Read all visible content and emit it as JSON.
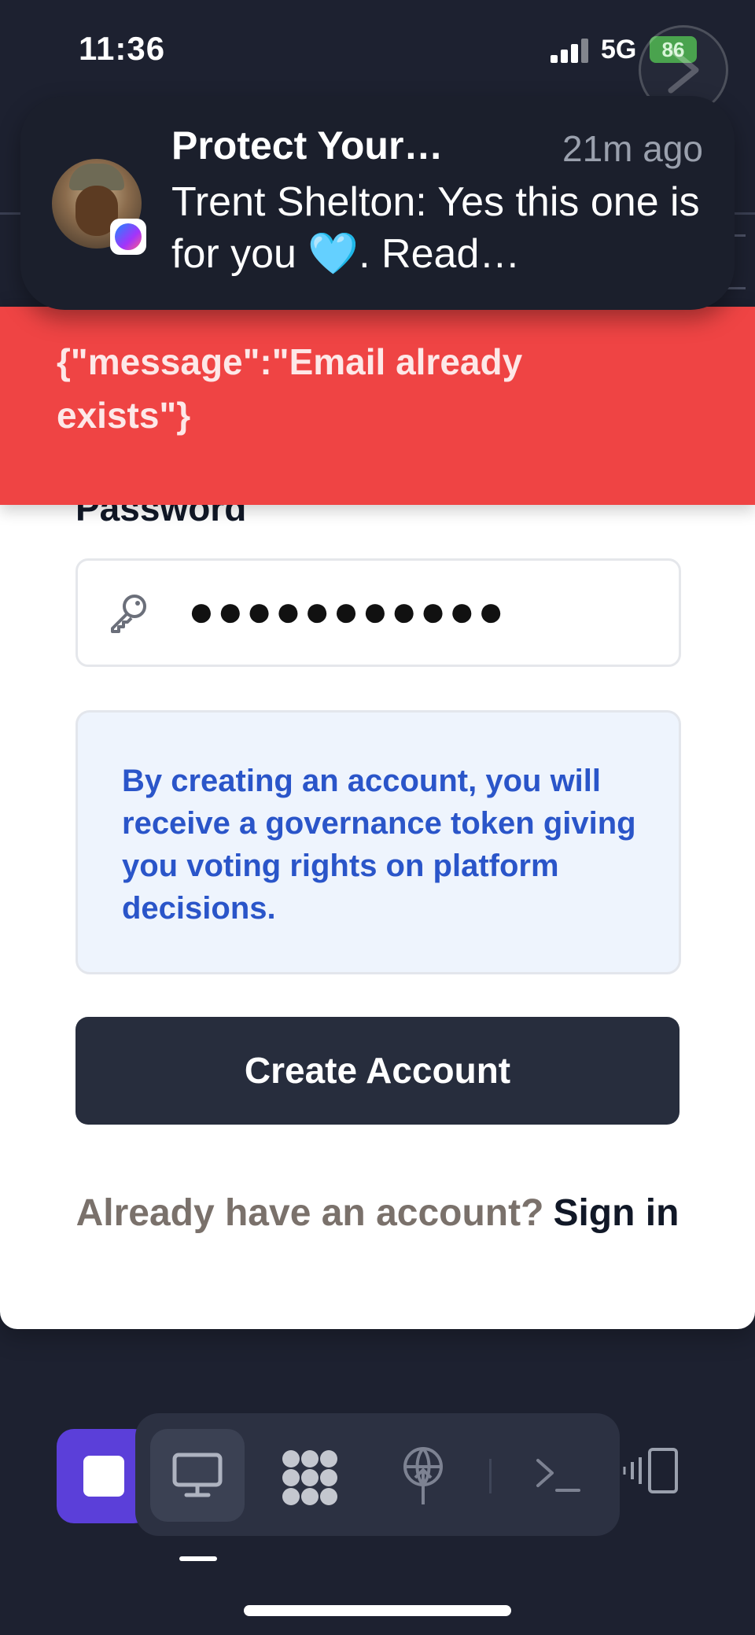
{
  "status_bar": {
    "time": "11:36",
    "network": "5G",
    "battery": "86"
  },
  "notification": {
    "title": "Protect Your…",
    "time": "21m ago",
    "body": "Trent Shelton: Yes this one is for you 🩵. Read…",
    "app_icon": "messenger-icon"
  },
  "error": {
    "message": "{\"message\":\"Email already exists\"}"
  },
  "form": {
    "password_label": "Password",
    "password_value": "●●●●●●●●●●●",
    "password_icon": "key-icon"
  },
  "info": {
    "text": "By creating an account, you will receive a governance token giving you voting rights on platform decisions."
  },
  "actions": {
    "create_account": "Create Account",
    "signin_prompt": "Already have an account?",
    "signin_link": "Sign in"
  },
  "dock": {
    "items": [
      "stop-icon",
      "desktop-icon",
      "apps-grid-icon",
      "antenna-icon",
      "terminal-icon",
      "multi-device-icon"
    ]
  },
  "colors": {
    "error_bg": "#ef4444",
    "info_text": "#2a55c9",
    "primary_button": "#272d3d",
    "accent_purple": "#5b3fd9"
  }
}
